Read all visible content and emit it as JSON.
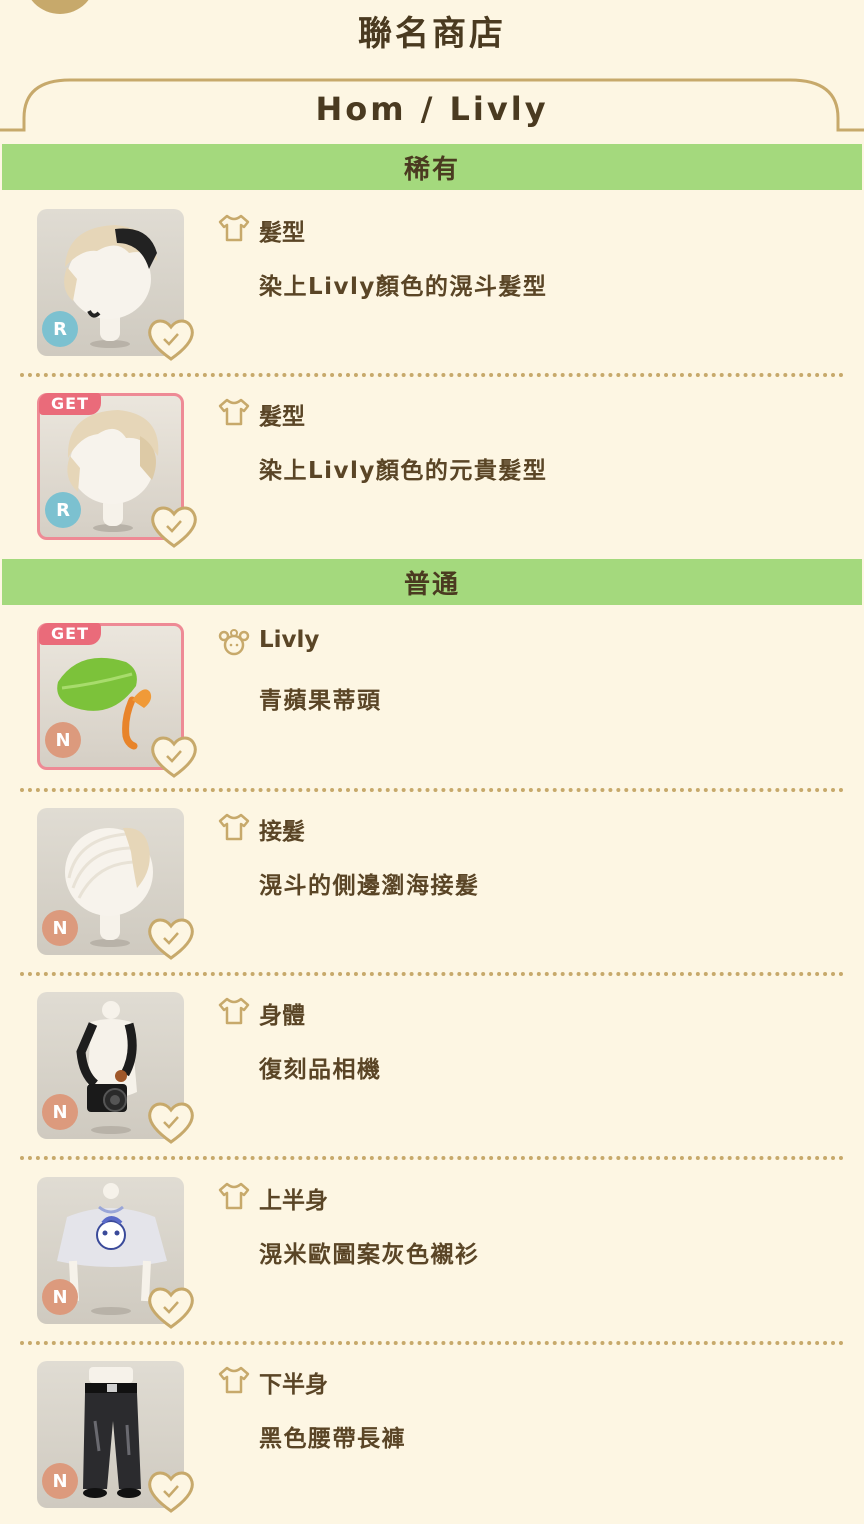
{
  "page": {
    "title": "聯名商店"
  },
  "tab": {
    "title": "Hom / Livly"
  },
  "sections": [
    {
      "title": "稀有"
    },
    {
      "title": "普通"
    }
  ],
  "items": [
    {
      "category": "髮型",
      "category_icon": "shirt-icon",
      "name": "染上Livly顏色的滉斗髮型",
      "rarity": "R",
      "owned": false,
      "art": "hairstyle-art"
    },
    {
      "category": "髮型",
      "category_icon": "shirt-icon",
      "name": "染上Livly顏色的元貴髮型",
      "rarity": "R",
      "owned": true,
      "get_label": "GET",
      "art": "hairstyle-art"
    },
    {
      "category": "Livly",
      "category_icon": "livly-icon",
      "name": "青蘋果蒂頭",
      "rarity": "N",
      "owned": true,
      "get_label": "GET",
      "art": "leaf-stem-art"
    },
    {
      "category": "接髮",
      "category_icon": "shirt-icon",
      "name": "滉斗的側邊瀏海接髮",
      "rarity": "N",
      "owned": false,
      "art": "hair-extension-art"
    },
    {
      "category": "身體",
      "category_icon": "shirt-icon",
      "name": "復刻品相機",
      "rarity": "N",
      "owned": false,
      "art": "camera-art"
    },
    {
      "category": "上半身",
      "category_icon": "shirt-icon",
      "name": "滉米歐圖案灰色襯衫",
      "rarity": "N",
      "owned": false,
      "art": "shirt-art"
    },
    {
      "category": "下半身",
      "category_icon": "shirt-icon",
      "name": "黑色腰帶長褲",
      "rarity": "N",
      "owned": false,
      "art": "pants-art"
    }
  ],
  "colors": {
    "background": "#fdf6e3",
    "section_header": "#a4d97d",
    "gold_accent": "#c7a96b",
    "get_tag": "#ea6b7a",
    "rarity_r": "#7cc1d0",
    "rarity_n": "#dc9a7d"
  }
}
